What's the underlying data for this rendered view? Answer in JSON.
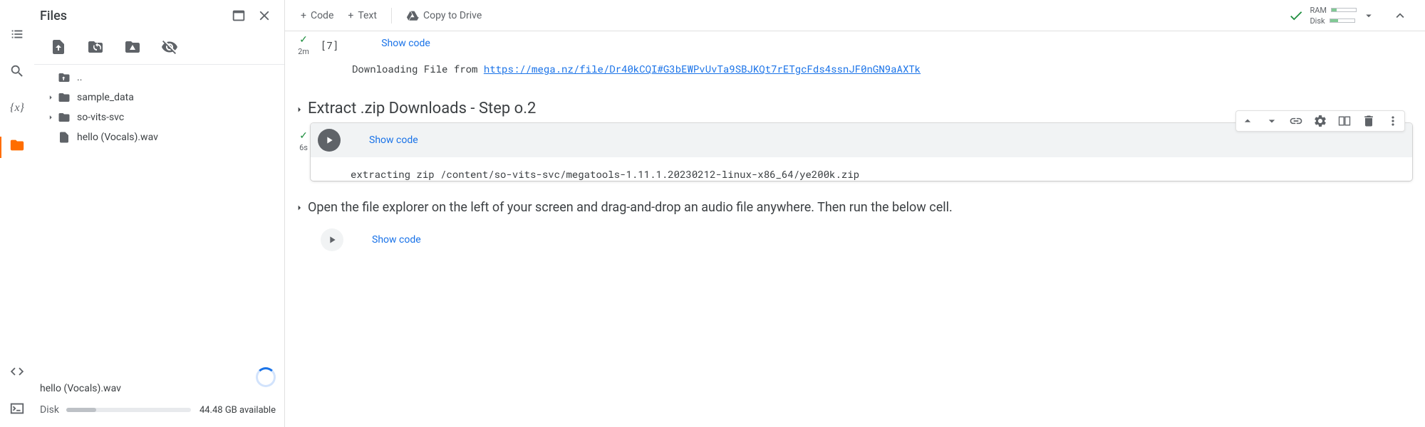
{
  "sidebar": {
    "title": "Files",
    "tree": {
      "up": "..",
      "items": [
        {
          "label": "sample_data"
        },
        {
          "label": "so-vits-svc"
        },
        {
          "label": "hello (Vocals).wav"
        }
      ]
    },
    "footer": {
      "filename": "hello (Vocals).wav",
      "disk_label": "Disk",
      "available": "44.48 GB available"
    }
  },
  "toolbar": {
    "code": "Code",
    "text": "Text",
    "copy": "Copy to Drive",
    "ram": "RAM",
    "disk": "Disk"
  },
  "cells": {
    "c0": {
      "showcode": "Show code",
      "exec": "[7]",
      "time": "2m",
      "output_prefix": "Downloading File from ",
      "output_link": "https://mega.nz/file/Dr40kCQI#G3bEWPvUvTa9SBJKQt7rETgcFds4ssnJF0nGN9aAXTk"
    },
    "c1": {
      "heading": "Extract .zip Downloads - Step o.2"
    },
    "c2": {
      "showcode": "Show code",
      "time": "6s",
      "output": "extracting zip /content/so-vits-svc/megatools-1.11.1.20230212-linux-x86_64/ye200k.zip"
    },
    "c3": {
      "text": "Open the file explorer on the left of your screen and drag-and-drop an audio file anywhere. Then run the below cell."
    },
    "c4": {
      "showcode": "Show code"
    }
  }
}
